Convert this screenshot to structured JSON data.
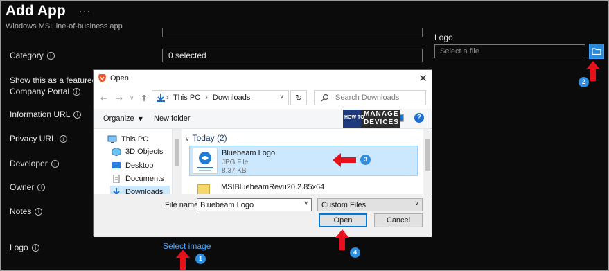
{
  "header": {
    "title": "Add App",
    "more_icon": "more-icon",
    "subtitle": "Windows MSI line-of-business app"
  },
  "form": {
    "category_label": "Category",
    "category_value": "0 selected",
    "featured_label_line1": "Show this as a featured",
    "featured_label_line2": "Company Portal",
    "info_url_label": "Information URL",
    "privacy_url_label": "Privacy URL",
    "developer_label": "Developer",
    "owner_label": "Owner",
    "notes_label": "Notes",
    "logo_label": "Logo",
    "select_image_link": "Select image",
    "info_glyph": "i"
  },
  "logo_panel": {
    "label": "Logo",
    "placeholder": "Select a file"
  },
  "dialog": {
    "title": "Open",
    "close_glyph": "✕",
    "breadcrumb": [
      "This PC",
      "Downloads"
    ],
    "breadcrumb_sep": "›",
    "search_placeholder": "Search Downloads",
    "toolbar": {
      "organize": "Organize",
      "new_folder": "New folder",
      "help_glyph": "?"
    },
    "nav_items": [
      "This PC",
      "3D Objects",
      "Desktop",
      "Documents",
      "Downloads"
    ],
    "group_header": "Today (2)",
    "selected_file": {
      "name": "Bluebeam Logo",
      "type": "JPG File",
      "size": "8.37 KB"
    },
    "second_file": "MSIBluebeamRevu20.2.85x64",
    "filename_label": "File name:",
    "filename_value": "Bluebeam Logo",
    "filetype_value": "Custom Files",
    "open_button": "Open",
    "cancel_button": "Cancel"
  },
  "watermark": {
    "line1": "HOW TO",
    "line2": "MANAGE",
    "line3": "DEVICES"
  },
  "callouts": [
    "1",
    "2",
    "3",
    "4"
  ],
  "colors": {
    "background": "#0b0b0b",
    "accent": "#2f8ee0",
    "link": "#4aa3ff",
    "arrow": "#e8101a",
    "selection": "#cce8ff"
  }
}
